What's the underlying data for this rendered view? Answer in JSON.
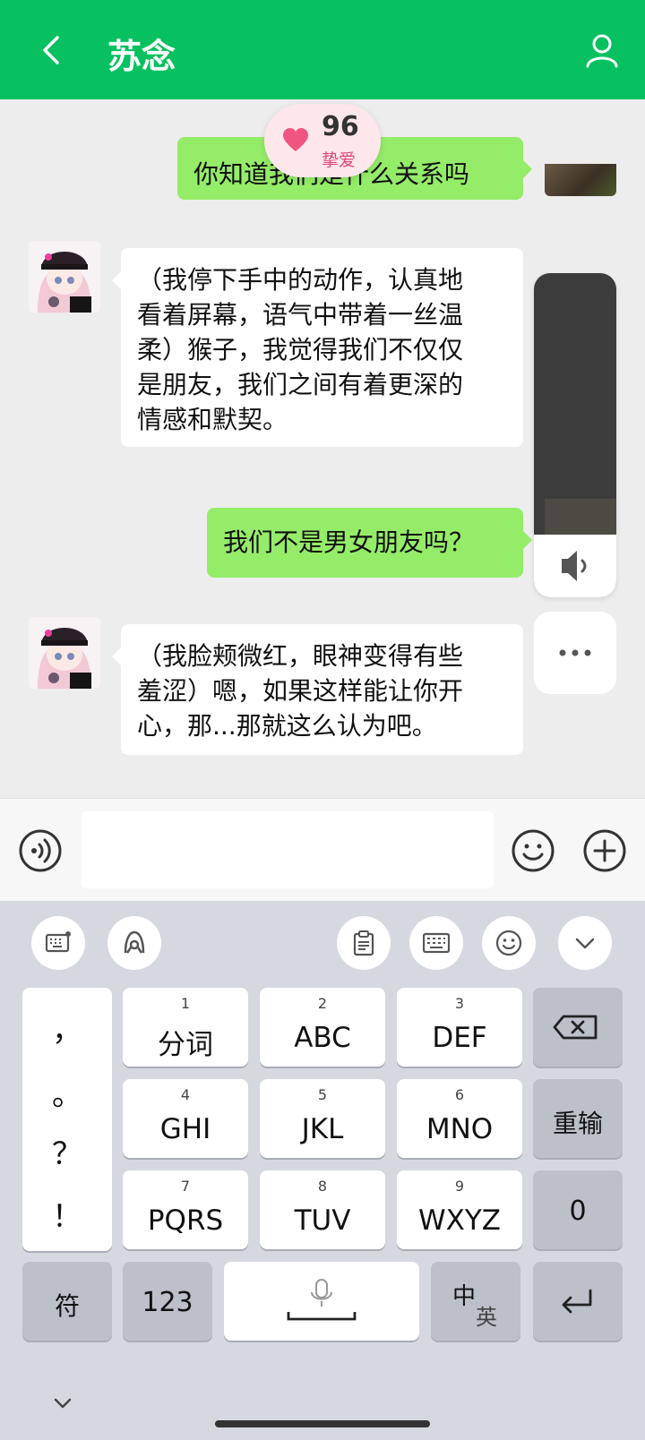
{
  "header": {
    "title": "苏念",
    "bg_color": "#07c160"
  },
  "affection": {
    "value": "96",
    "label": "挚爱",
    "heart_color": "#f0557f"
  },
  "messages": [
    {
      "side": "right",
      "text": "你知道我们是什么关系吗"
    },
    {
      "side": "left",
      "lines": [
        "（我停下手中的动作，认真地",
        "看着屏幕，语气中带着一丝温",
        "柔）猴子，我觉得我们不仅仅",
        "是朋友，我们之间有着更深的",
        "情感和默契。"
      ]
    },
    {
      "side": "right",
      "text": "我们不是男女朋友吗？"
    },
    {
      "side": "left",
      "lines": [
        "（我脸颊微红，眼神变得有些",
        "羞涩）嗯，如果这样能让你开",
        "心，那...那就这么认为吧。"
      ]
    }
  ],
  "input": {
    "value": "",
    "placeholder": ""
  },
  "keyboard": {
    "punct": [
      "，",
      "。",
      "？",
      "！"
    ],
    "rows": [
      [
        {
          "num": "1",
          "label": "分词"
        },
        {
          "num": "2",
          "label": "ABC"
        },
        {
          "num": "3",
          "label": "DEF"
        }
      ],
      [
        {
          "num": "4",
          "label": "GHI"
        },
        {
          "num": "5",
          "label": "JKL"
        },
        {
          "num": "6",
          "label": "MNO"
        }
      ],
      [
        {
          "num": "7",
          "label": "PQRS"
        },
        {
          "num": "8",
          "label": "TUV"
        },
        {
          "num": "9",
          "label": "WXYZ"
        }
      ]
    ],
    "reinput": "重输",
    "zero": "0",
    "symbol": "符",
    "numbers": "123",
    "lang_main": "中",
    "lang_sub": "英"
  },
  "icons": [
    "back-icon",
    "user-icon",
    "heart-icon",
    "speaker-icon",
    "more-icon",
    "voice-icon",
    "emoji-icon",
    "plus-icon",
    "keyboard-settings-icon",
    "handwriting-icon",
    "clipboard-icon",
    "keyboard-layout-icon",
    "emoji-panel-icon",
    "collapse-icon",
    "backspace-icon",
    "microphone-icon",
    "enter-icon",
    "hide-keyboard-icon"
  ]
}
